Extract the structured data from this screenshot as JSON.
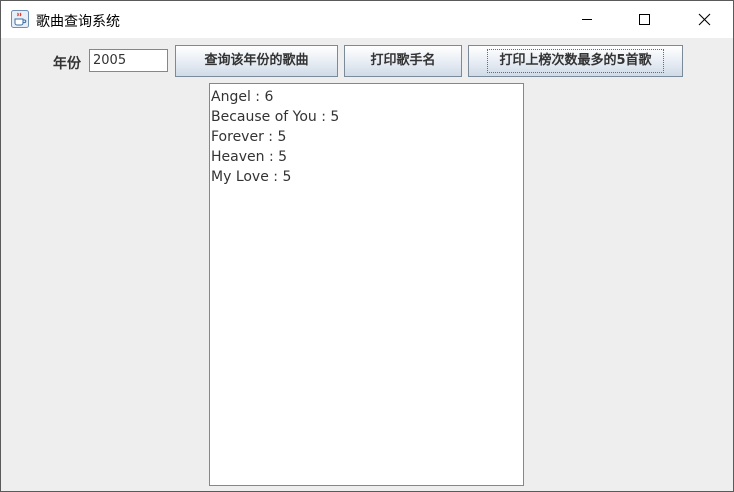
{
  "window": {
    "title": "歌曲查询系统",
    "icon": "java-coffee-cup-icon"
  },
  "controls": {
    "minimize_icon": "minimize-icon",
    "maximize_icon": "maximize-icon",
    "close_icon": "close-icon"
  },
  "toolbar": {
    "year_label": "年份",
    "year_value": "2005",
    "query_button": "查询该年份的歌曲",
    "print_singers_button": "打印歌手名",
    "print_top5_button": "打印上榜次数最多的5首歌"
  },
  "results": [
    "Angel : 6",
    "Because of You : 5",
    "Forever : 5",
    "Heaven : 5",
    "My Love : 5"
  ],
  "colors": {
    "window_background": "#eeeeee",
    "titlebar_background": "#ffffff",
    "button_border": "#7a8a99",
    "text": "#333333"
  }
}
